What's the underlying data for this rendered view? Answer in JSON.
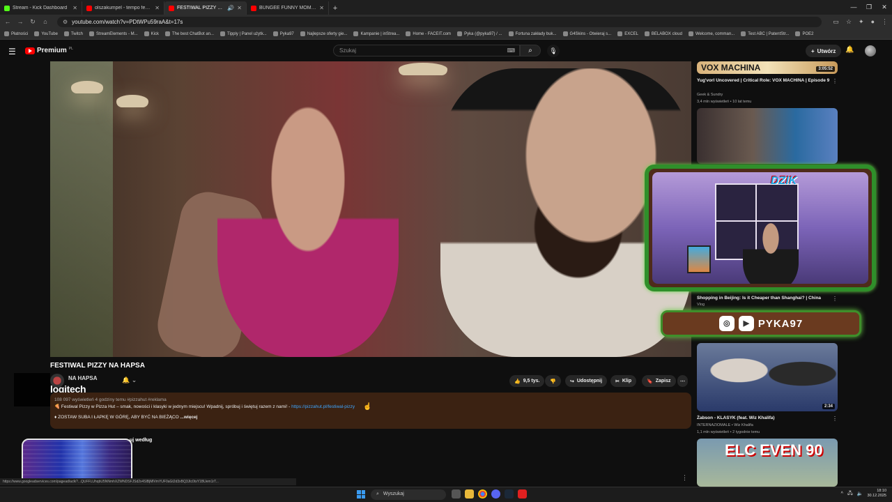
{
  "browser": {
    "tabs": [
      {
        "title": "Stream - Kick Dashboard",
        "color": "#53fc18",
        "active": false
      },
      {
        "title": "olszakumpel - tempo feat. sapi",
        "color": "#ff0000",
        "active": false
      },
      {
        "title": "FESTIWAL PIZZY NA HAPSA",
        "color": "#ff0000",
        "active": true
      },
      {
        "title": "BUNGEE FUNNY MOMENTS 2024",
        "color": "#ff0000",
        "active": false
      }
    ],
    "url": "youtube.com/watch?v=PDtWPu59raA&t=17s",
    "bookmarks": [
      "Płatności",
      "YouTube",
      "Twitch",
      "StreamElements - M...",
      "Kick",
      "The best ChatBot an...",
      "Tipply | Panel użytk...",
      "Pyka97",
      "Najlepsze oferty gie...",
      "Kampanie | inStrea...",
      "Home - FACEIT.com",
      "Pyka (@pyka97) / ...",
      "Fortuna zakłady buk...",
      "G4Skins - Otwieraj s...",
      "EXCEL",
      "BELABOX cloud",
      "Welcome, comman...",
      "Test ABC | PatentStr...",
      "POE2"
    ]
  },
  "yt_header": {
    "logo_text": "Premium",
    "logo_region": "PL",
    "search_placeholder": "Szukaj",
    "create_label": "Utwórz"
  },
  "video": {
    "title": "FESTIWAL PIZZY NA HAPSA",
    "channel": "NA HAPSA",
    "logitech_overlay": "logitech",
    "likes": "9,5 tys.",
    "share_label": "Udostępnij",
    "clip_label": "Klip",
    "save_label": "Zapisz",
    "views_meta": "108 097 wyświetleń  4 godziny temu  #pizzahut #reklama",
    "description_line1": "🍕 Festiwal Pizzy w Pizza Hut – smak, nowości i klasyki w jednym miejscu! Wpadnij, spróbuj i świętuj razem z nami! - ",
    "description_link": "https://pizzahut.pl/festiwal-pizzy",
    "description_line2": "♦ ZOSTAW SUBA I ŁAPKĘ W GÓRĘ, ABY BYĆ NA BIEŻĄCO ",
    "more_label": "...więcej",
    "sort_label": "uj według"
  },
  "status_url": "https://www.googleadservices.com/pagead/aclk?...QUFFLUhqbU5NNmhXZWNDSFJSd2x4SlBjMlVmYUF0aGt2d3xBQ3Jtc0tsY1BUem1rT...",
  "recommended": [
    {
      "title": "Yug'vorl Uncovered | Critical Role: VOX MACHINA | Episode 9",
      "channel": "Geek & Sundry",
      "meta": "3,4 mln wyświetleń • 10 lat temu",
      "duration": "3:05:52",
      "thumb_text": "VOX MACHINA"
    },
    {
      "title": "Shopping in Beijing: Is it Cheaper than Shanghai? | China",
      "channel": "Vlog",
      "meta": "",
      "duration": "",
      "thumb_text": ""
    },
    {
      "title": "Żabson - KLASYK (feat. Wiz Khalifa)",
      "channel": "INTERNAZIOMALE • Wiz Khalifa",
      "meta": "1,1 mln wyświetleń • 2 tygodnie temu",
      "duration": "2:34",
      "thumb_text": ""
    },
    {
      "title": "",
      "channel": "",
      "meta": "",
      "duration": "",
      "thumb_text": "ELC EVEN 90"
    }
  ],
  "overlay": {
    "brand": "DZIK",
    "handle": "PYKA97"
  },
  "taskbar": {
    "search_label": "Wyszukaj",
    "time": "18:10",
    "date": "30.12.2025"
  },
  "colors": {
    "yt_red": "#ff0000",
    "link_blue": "#3ea6ff",
    "overlay_green": "#2f8f2a",
    "overlay_brown": "#6a3a1f",
    "desc_bg": "#3b2212"
  }
}
